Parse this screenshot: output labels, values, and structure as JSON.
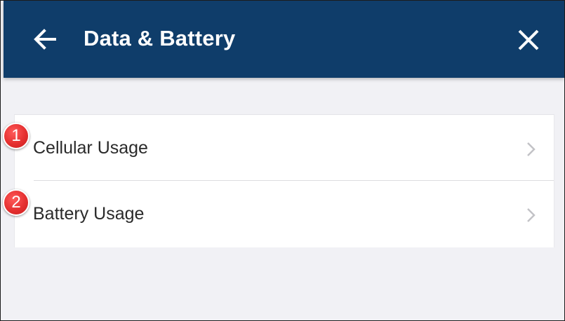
{
  "header": {
    "title": "Data & Battery",
    "back_icon": "arrow-left-icon",
    "close_icon": "close-icon",
    "background_color": "#0f3d6a"
  },
  "menu": {
    "items": [
      {
        "label": "Cellular Usage",
        "icon": "chevron-right-icon"
      },
      {
        "label": "Battery Usage",
        "icon": "chevron-right-icon"
      }
    ]
  },
  "annotations": {
    "badges": [
      "1",
      "2"
    ],
    "badge_color": "#e53030"
  }
}
